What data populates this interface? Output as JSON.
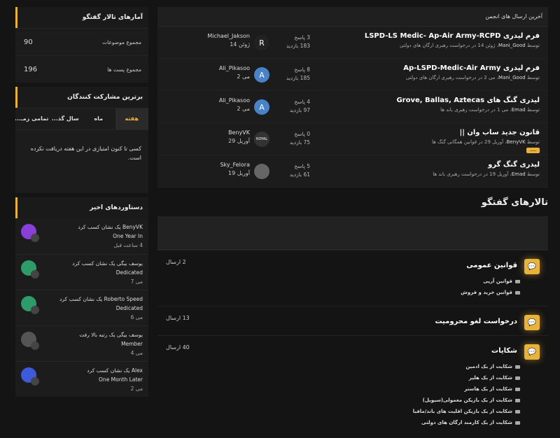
{
  "stats": {
    "title": "آمارهای تالار گفتگو",
    "rows": [
      {
        "label": "مجموع موضوعات",
        "value": "90"
      },
      {
        "label": "مجموع پست ها",
        "value": "196"
      }
    ]
  },
  "top": {
    "title": "برترین مشارکت کنندگان",
    "tabs": [
      "هفته",
      "ماه",
      "سال گذ...",
      "تمامی زمـ..."
    ],
    "empty": "کسی تا کنون امتیازی در این هفته دریافت نکرده است."
  },
  "achievements": {
    "title": "دستاوردهای اخیر",
    "items": [
      {
        "line1": "BenyVK یک نشان کسب کرد",
        "line2": "One Year In",
        "time": "4 ساعت قبل",
        "color": "#8b3fd9"
      },
      {
        "line1": "یوسف بیگی یک نشان کسب کرد",
        "line2": "Dedicated",
        "time": "می 7",
        "color": "#2e9b6a"
      },
      {
        "line1": "Roberto Speed یک نشان کسب کرد",
        "line2": "Dedicated",
        "time": "می 6",
        "color": "#2e9b6a"
      },
      {
        "line1": "یوسف بیگی یک رتبه بالا رفت",
        "line2": "Member",
        "time": "می 4",
        "color": "#555"
      },
      {
        "line1": "Alex یک نشان کسب کرد",
        "line2": "One Month Later",
        "time": "می 2",
        "color": "#3d5ad9"
      }
    ]
  },
  "latest": {
    "title": "آخرین ارسال های انجمن",
    "threads": [
      {
        "title": "فرم لیدری LSPD-LS Medic- Ap-Air Army-RCPD",
        "by": "توسط",
        "author": "Mani_Good",
        "date": "ژوئن 14",
        "in": "در",
        "forum": "درخواست رهبری ارگان های دولتی",
        "replies": "3 پاسخ",
        "views": "183 بازدید",
        "user": "Michael_Jakson",
        "udate": "ژوئن 14",
        "avatar": "R",
        "avcolor": "#222",
        "tag": ""
      },
      {
        "title": "فرم لیدری Ap-LSPD-Medic-Air Army",
        "by": "توسط",
        "author": "Mani_Good",
        "date": "می 2",
        "in": "در",
        "forum": "درخواست رهبری ارگان های دولتی",
        "replies": "8 پاسخ",
        "views": "185 بازدید",
        "user": "Ali_Pikasoo",
        "udate": "می 2",
        "avatar": "A",
        "avcolor": "#4a82c8",
        "tag": ""
      },
      {
        "title": "لیدری گنگ های Grove, Ballas, Aztecas",
        "by": "توسط",
        "author": "Emad",
        "date": "می 1",
        "in": "در",
        "forum": "درخواست رهبری باند ها",
        "replies": "4 پاسخ",
        "views": "97 بازدید",
        "user": "Ali_Pikasoo",
        "udate": "می 2",
        "avatar": "A",
        "avcolor": "#4a82c8",
        "tag": ""
      },
      {
        "title": "قانون جدید ساب وان ||",
        "by": "توسط",
        "author": "BenyVK",
        "date": "آوریل 29",
        "in": "در",
        "forum": "قوانین همگانی گنگ ها",
        "replies": "0 پاسخ",
        "views": "75 بازدید",
        "user": "BenyVK",
        "udate": "آوریل 29",
        "avatar": "ROYAL",
        "avcolor": "#333",
        "tag": "ــــــ"
      },
      {
        "title": "لیدری گنگ گرو",
        "by": "توسط",
        "author": "Emad",
        "date": "آوریل 19",
        "in": "در",
        "forum": "درخواست رهبری باند ها",
        "replies": "5 پاسخ",
        "views": "61 بازدید",
        "user": "Sky_Felora",
        "udate": "آوریل 19",
        "avatar": "",
        "avcolor": "#666",
        "tag": ""
      }
    ]
  },
  "forums": {
    "title": "تالارهای گفتگو",
    "items": [
      {
        "title": "قوانین عمومی",
        "count": "2 ارسال",
        "subs": [
          "قوانین آرپی",
          "قوانین خرید و فروش"
        ]
      },
      {
        "title": "درخواست لغو محرومیت",
        "count": "13 ارسال",
        "subs": []
      },
      {
        "title": "شکایات",
        "count": "40 ارسال",
        "subs": [
          "شکایت از یک ادمین",
          "شکایت از یک هلپر",
          "شکایت از یک هاستر",
          "شکایت از یک بازیکن معمولی(سیویل)",
          "شکایت از یک بازیکن اقلیت های باند/مافیا",
          "شکایت از یک کارمند ارگان های دولتی"
        ]
      }
    ]
  }
}
